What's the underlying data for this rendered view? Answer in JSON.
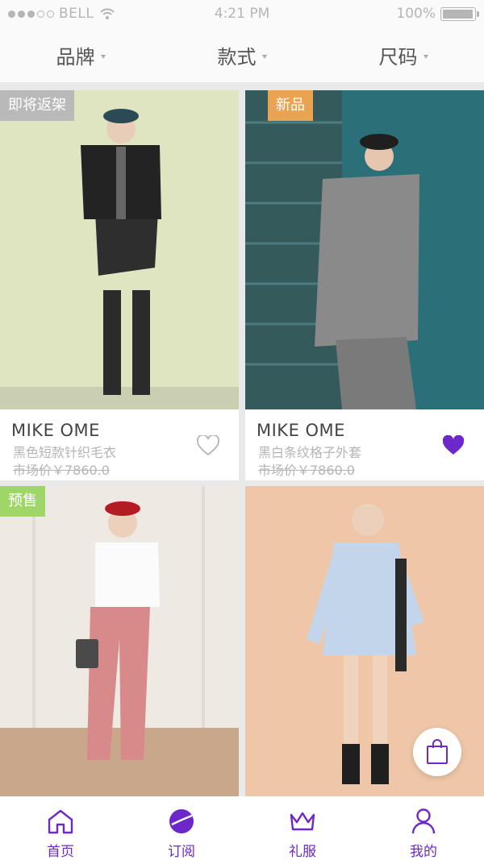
{
  "status_bar": {
    "carrier": "BELL",
    "time": "4:21 PM",
    "battery": "100%"
  },
  "filters": [
    {
      "label": "品牌"
    },
    {
      "label": "款式"
    },
    {
      "label": "尺码"
    }
  ],
  "products": [
    {
      "tag": "即将返架",
      "tag_color": "#b9b9b9",
      "brand": "MIKE OME",
      "name": "黑色短款针织毛衣",
      "price": "市场价￥7860.0",
      "favorited": false,
      "photo_bg": "#dfe5c1"
    },
    {
      "tag": "新品",
      "tag_color": "#eaa451",
      "brand": "MIKE OME",
      "name": "黑白条纹格子外套",
      "price": "市场价￥7860.0",
      "favorited": true,
      "photo_bg": "#2b6f79"
    },
    {
      "tag": "预售",
      "tag_color": "#9fd667",
      "photo_bg": "#efe9e3"
    },
    {
      "photo_bg": "#efc7a8"
    }
  ],
  "tabs": [
    {
      "label": "首页",
      "icon": "home-icon"
    },
    {
      "label": "订阅",
      "icon": "subscribe-icon"
    },
    {
      "label": "礼服",
      "icon": "crown-icon"
    },
    {
      "label": "我的",
      "icon": "profile-icon"
    }
  ],
  "colors": {
    "accent": "#6d28c9",
    "muted": "#b5b5b5"
  }
}
